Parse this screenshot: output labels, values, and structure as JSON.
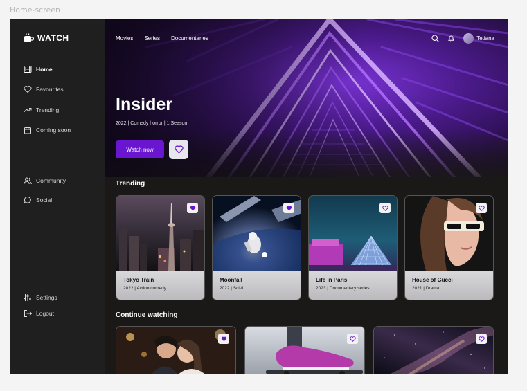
{
  "frame_label": "Home-screen",
  "brand": {
    "name": "WATCH"
  },
  "sidebar": {
    "items": [
      {
        "label": "Home",
        "icon": "film-icon",
        "active": true
      },
      {
        "label": "Favourites",
        "icon": "heart-icon"
      },
      {
        "label": "Trending",
        "icon": "trending-icon"
      },
      {
        "label": "Coming soon",
        "icon": "calendar-icon"
      },
      {
        "label": "Community",
        "icon": "users-icon"
      },
      {
        "label": "Social",
        "icon": "chat-icon"
      },
      {
        "label": "Settings",
        "icon": "sliders-icon"
      },
      {
        "label": "Logout",
        "icon": "logout-icon"
      }
    ]
  },
  "topnav": {
    "items": [
      "Movies",
      "Series",
      "Documentaries"
    ]
  },
  "user": {
    "name": "Tetiana"
  },
  "hero": {
    "title": "Insider",
    "meta": "2022 | Comedy horror | 1 Season",
    "watch_label": "Watch now"
  },
  "trending": {
    "title": "Trending",
    "cards": [
      {
        "title": "Tokyo Train",
        "meta": "2022 | Action comedy",
        "favourited": true
      },
      {
        "title": "Moonfall",
        "meta": "2022 | Sci-fi",
        "favourited": true
      },
      {
        "title": "Life in Paris",
        "meta": "2023 | Documentary series",
        "favourited": false
      },
      {
        "title": "House of Gucci",
        "meta": "2021 | Drama",
        "favourited": false
      }
    ]
  },
  "continue": {
    "title": "Continue watching"
  },
  "colors": {
    "accent": "#6a16d1",
    "sidebar": "#1f1f1f",
    "background": "#1b1918"
  }
}
